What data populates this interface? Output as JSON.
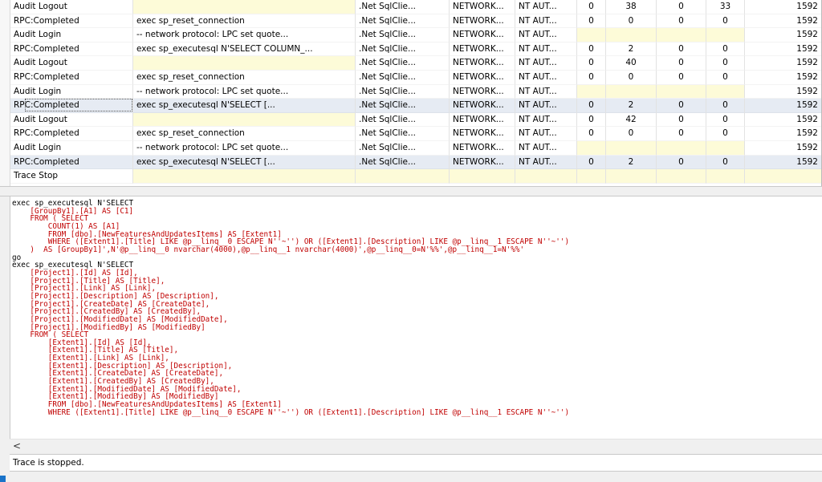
{
  "trace_rows": [
    {
      "event": "Audit Logout",
      "text": "",
      "app": ".Net SqlClie...",
      "ntuser": "NETWORK...",
      "login": "NT AUT...",
      "cpu": "0",
      "reads": "38",
      "writes": "0",
      "duration": "33",
      "pid": "1592"
    },
    {
      "event": "RPC:Completed",
      "text": "exec sp_reset_connection",
      "app": ".Net SqlClie...",
      "ntuser": "NETWORK...",
      "login": "NT AUT...",
      "cpu": "0",
      "reads": "0",
      "writes": "0",
      "duration": "0",
      "pid": "1592"
    },
    {
      "event": "Audit Login",
      "text": "-- network protocol: LPC  set quote...",
      "app": ".Net SqlClie...",
      "ntuser": "NETWORK...",
      "login": "NT AUT...",
      "cpu": "",
      "reads": "",
      "writes": "",
      "duration": "",
      "pid": "1592"
    },
    {
      "event": "RPC:Completed",
      "text": "exec sp_executesql N'SELECT COLUMN_...",
      "app": ".Net SqlClie...",
      "ntuser": "NETWORK...",
      "login": "NT AUT...",
      "cpu": "0",
      "reads": "2",
      "writes": "0",
      "duration": "0",
      "pid": "1592"
    },
    {
      "event": "Audit Logout",
      "text": "",
      "app": ".Net SqlClie...",
      "ntuser": "NETWORK...",
      "login": "NT AUT...",
      "cpu": "0",
      "reads": "40",
      "writes": "0",
      "duration": "0",
      "pid": "1592"
    },
    {
      "event": "RPC:Completed",
      "text": "exec sp_reset_connection",
      "app": ".Net SqlClie...",
      "ntuser": "NETWORK...",
      "login": "NT AUT...",
      "cpu": "0",
      "reads": "0",
      "writes": "0",
      "duration": "0",
      "pid": "1592"
    },
    {
      "event": "Audit Login",
      "text": "-- network protocol: LPC  set quote...",
      "app": ".Net SqlClie...",
      "ntuser": "NETWORK...",
      "login": "NT AUT...",
      "cpu": "",
      "reads": "",
      "writes": "",
      "duration": "",
      "pid": "1592"
    },
    {
      "event": "RPC:Completed",
      "text": "exec sp_executesql N'SELECT        [...",
      "app": ".Net SqlClie...",
      "ntuser": "NETWORK...",
      "login": "NT AUT...",
      "cpu": "0",
      "reads": "2",
      "writes": "0",
      "duration": "0",
      "pid": "1592"
    },
    {
      "event": "Audit Logout",
      "text": "",
      "app": ".Net SqlClie...",
      "ntuser": "NETWORK...",
      "login": "NT AUT...",
      "cpu": "0",
      "reads": "42",
      "writes": "0",
      "duration": "0",
      "pid": "1592"
    },
    {
      "event": "RPC:Completed",
      "text": "exec sp_reset_connection",
      "app": ".Net SqlClie...",
      "ntuser": "NETWORK...",
      "login": "NT AUT...",
      "cpu": "0",
      "reads": "0",
      "writes": "0",
      "duration": "0",
      "pid": "1592"
    },
    {
      "event": "Audit Login",
      "text": "-- network protocol: LPC  set quote...",
      "app": ".Net SqlClie...",
      "ntuser": "NETWORK...",
      "login": "NT AUT...",
      "cpu": "",
      "reads": "",
      "writes": "",
      "duration": "",
      "pid": "1592"
    },
    {
      "event": "RPC:Completed",
      "text": "exec sp_executesql N'SELECT        [...",
      "app": ".Net SqlClie...",
      "ntuser": "NETWORK...",
      "login": "NT AUT...",
      "cpu": "0",
      "reads": "2",
      "writes": "0",
      "duration": "0",
      "pid": "1592"
    },
    {
      "event": "Trace Stop",
      "text": "",
      "app": "",
      "ntuser": "",
      "login": "",
      "cpu": "",
      "reads": "",
      "writes": "",
      "duration": "",
      "pid": ""
    }
  ],
  "selected_rows": [
    7,
    11
  ],
  "focused_row": 7,
  "sql_detail": [
    {
      "t": "exec sp_executesql N'SELECT",
      "k": true
    },
    {
      "t": "    [GroupBy1].[A1] AS [C1]"
    },
    {
      "t": "    FROM ( SELECT"
    },
    {
      "t": "        COUNT(1) AS [A1]"
    },
    {
      "t": "        FROM [dbo].[NewFeaturesAndUpdatesItems] AS [Extent1]"
    },
    {
      "t": "        WHERE ([Extent1].[Title] LIKE @p__linq__0 ESCAPE N''~'') OR ([Extent1].[Description] LIKE @p__linq__1 ESCAPE N''~'')"
    },
    {
      "t": "    )  AS [GroupBy1]',N'@p__linq__0 nvarchar(4000),@p__linq__1 nvarchar(4000)',@p__linq__0=N'%%',@p__linq__1=N'%%'"
    },
    {
      "t": "go",
      "k": true
    },
    {
      "t": "exec sp_executesql N'SELECT",
      "k": true
    },
    {
      "t": "    [Project1].[Id] AS [Id],"
    },
    {
      "t": "    [Project1].[Title] AS [Title],"
    },
    {
      "t": "    [Project1].[Link] AS [Link],"
    },
    {
      "t": "    [Project1].[Description] AS [Description],"
    },
    {
      "t": "    [Project1].[CreateDate] AS [CreateDate],"
    },
    {
      "t": "    [Project1].[CreatedBy] AS [CreatedBy],"
    },
    {
      "t": "    [Project1].[ModifiedDate] AS [ModifiedDate],"
    },
    {
      "t": "    [Project1].[ModifiedBy] AS [ModifiedBy]"
    },
    {
      "t": "    FROM ( SELECT"
    },
    {
      "t": "        [Extent1].[Id] AS [Id],"
    },
    {
      "t": "        [Extent1].[Title] AS [Title],"
    },
    {
      "t": "        [Extent1].[Link] AS [Link],"
    },
    {
      "t": "        [Extent1].[Description] AS [Description],"
    },
    {
      "t": "        [Extent1].[CreateDate] AS [CreateDate],"
    },
    {
      "t": "        [Extent1].[CreatedBy] AS [CreatedBy],"
    },
    {
      "t": "        [Extent1].[ModifiedDate] AS [ModifiedDate],"
    },
    {
      "t": "        [Extent1].[ModifiedBy] AS [ModifiedBy]"
    },
    {
      "t": "        FROM [dbo].[NewFeaturesAndUpdatesItems] AS [Extent1]"
    },
    {
      "t": "        WHERE ([Extent1].[Title] LIKE @p__linq__0 ESCAPE N''~'') OR ([Extent1].[Description] LIKE @p__linq__1 ESCAPE N''~'')"
    }
  ],
  "scroll_left_glyph": "<",
  "status_text": "Trace is stopped.",
  "colors": {
    "sql_text": "#c00000",
    "keyword_text": "#000000",
    "empty_cell_highlight": "#fdfbd8",
    "selected_row": "#e6ebf3",
    "accent": "#1a73c9"
  }
}
